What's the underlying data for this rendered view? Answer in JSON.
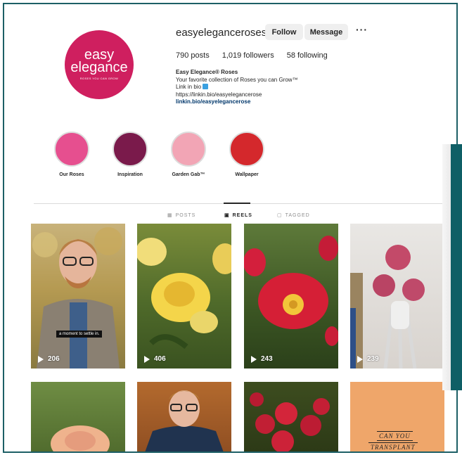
{
  "profile": {
    "username": "easyeleganceroses",
    "avatar_text": {
      "line1": "easy",
      "line2": "elegance",
      "line3": "ROSES YOU CAN GROW"
    },
    "buttons": {
      "follow": "Follow",
      "message": "Message"
    },
    "more": "···",
    "stats": {
      "posts": "790 posts",
      "followers": "1,019 followers",
      "following": "58 following"
    },
    "bio": {
      "name": "Easy Elegance® Roses",
      "line1": "Your favorite collection of Roses you can Grow™",
      "line2": "Link in bio",
      "line3": "https://linkin.bio/easyelegancerose",
      "link": "linkin.bio/easyelegancerose"
    }
  },
  "highlights": [
    {
      "label": "Our Roses",
      "color": "#e64f8f"
    },
    {
      "label": "Inspiration",
      "color": "#7a1a4b"
    },
    {
      "label": "Garden Gab™",
      "color": "#f2a5b5"
    },
    {
      "label": "Wallpaper",
      "color": "#d4282c"
    }
  ],
  "tabs": {
    "posts": "POSTS",
    "reels": "REELS",
    "tagged": "TAGGED"
  },
  "reels": [
    {
      "views": "206",
      "caption": "a moment to settle in."
    },
    {
      "views": "406"
    },
    {
      "views": "243"
    },
    {
      "views": "239"
    }
  ],
  "tile5_text": {
    "line1": "CAN YOU",
    "line2": "TRANSPLANT"
  },
  "colors": {
    "brand": "#cf1f5f",
    "frame": "#1d5f66",
    "link": "#00376b"
  }
}
